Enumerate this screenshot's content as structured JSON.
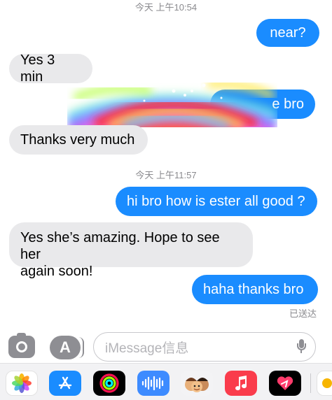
{
  "timestamps": {
    "first": "今天 上午10:54",
    "second": "今天 上午11:57"
  },
  "messages": {
    "m1": "near?",
    "m2": "Yes 3 min",
    "m3": "e bro",
    "m4": "Thanks very much",
    "m5": "hi bro how is ester all good ?",
    "m6_line1": "Yes she’s amazing. Hope to see her",
    "m6_line2": "again soon!",
    "m7": "haha thanks bro"
  },
  "status": {
    "delivered": "已送达"
  },
  "composer": {
    "placeholder": "iMessage信息",
    "store_glyph": "A"
  },
  "apps": [
    "photos-icon",
    "app-store-icon",
    "activity-icon",
    "audio-message-icon",
    "memoji-icon",
    "music-icon",
    "digital-touch-icon"
  ],
  "colors": {
    "outgoing": "#1a8cff",
    "incoming": "#e9e9eb",
    "timestamp": "#8a8a8e"
  }
}
